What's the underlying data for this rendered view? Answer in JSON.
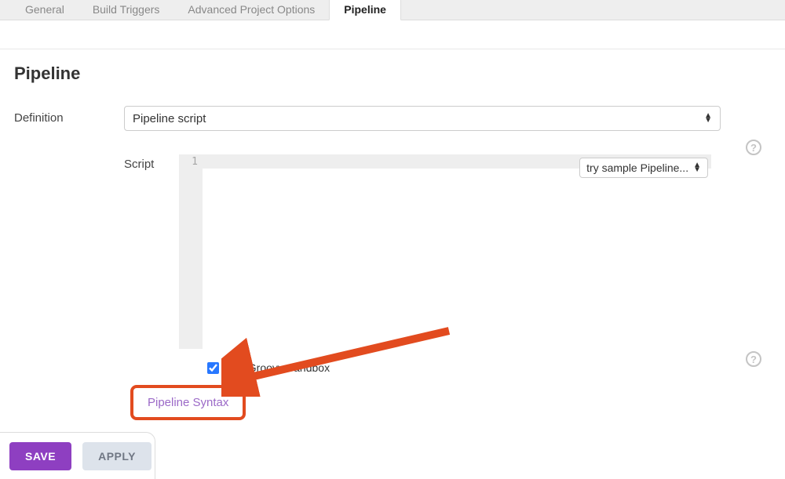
{
  "tabs": {
    "general": "General",
    "build_triggers": "Build Triggers",
    "advanced_project_options": "Advanced Project Options",
    "pipeline": "Pipeline"
  },
  "section": {
    "title": "Pipeline"
  },
  "definition": {
    "label": "Definition",
    "value": "Pipeline script"
  },
  "script": {
    "label": "Script",
    "line_number": "1",
    "sample_select": "try sample Pipeline..."
  },
  "sandbox": {
    "label": "Use Groovy Sandbox",
    "checked": true
  },
  "syntax_link": "Pipeline Syntax",
  "buttons": {
    "save": "SAVE",
    "apply": "APPLY"
  }
}
